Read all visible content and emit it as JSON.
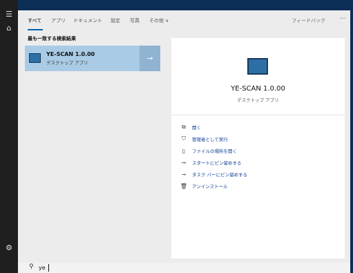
{
  "rail": {
    "menu_icon": "hamburger-icon",
    "home_icon": "home-icon",
    "settings_icon": "gear-icon"
  },
  "tabs": [
    {
      "label": "すべて",
      "active": true
    },
    {
      "label": "アプリ"
    },
    {
      "label": "ドキュメント"
    },
    {
      "label": "設定"
    },
    {
      "label": "写真"
    },
    {
      "label": "その他 ∨"
    }
  ],
  "header": {
    "feedback_label": "フィードバック",
    "more_label": "···"
  },
  "results": {
    "section_title": "最も一致する検索結果",
    "best_match": {
      "name": "YE-SCAN 1.0.00",
      "type": "デスクトップ アプリ",
      "arrow": "→"
    }
  },
  "detail": {
    "name": "YE-SCAN 1.0.00",
    "type": "デスクトップ アプリ",
    "actions": [
      {
        "icon": "open-icon",
        "glyph": "⧉",
        "label": "開く"
      },
      {
        "icon": "admin-run-icon",
        "glyph": "⛉",
        "label": "管理者として実行"
      },
      {
        "icon": "file-location-icon",
        "glyph": "▯",
        "label": "ファイルの場所を開く"
      },
      {
        "icon": "pin-start-icon",
        "glyph": "⊸",
        "label": "スタートにピン留めする"
      },
      {
        "icon": "pin-taskbar-icon",
        "glyph": "⊸",
        "label": "タスク バーにピン留めする"
      },
      {
        "icon": "uninstall-icon",
        "glyph": "🗑",
        "label": "アンインストール"
      }
    ]
  },
  "search": {
    "icon": "search-icon",
    "query": "ye"
  },
  "colors": {
    "accent": "#0063b1",
    "selection": "#a9cbe5",
    "rail": "#1f1f1f"
  }
}
